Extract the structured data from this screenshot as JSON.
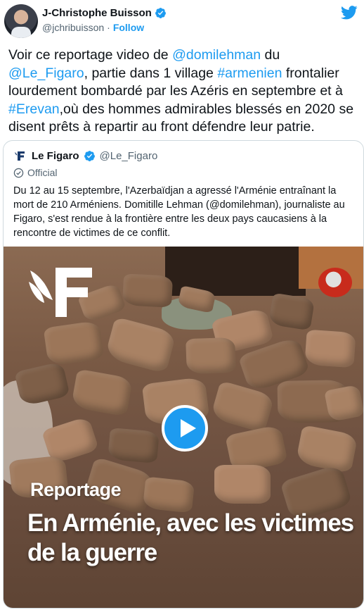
{
  "author": {
    "name": "J-Christophe Buisson",
    "handle": "@jchribuisson",
    "separator": "·",
    "follow_label": "Follow"
  },
  "tweet": {
    "segments": [
      {
        "text": "Voir ce reportage video de ",
        "link": false
      },
      {
        "text": "@domilehman",
        "link": true
      },
      {
        "text": " du ",
        "link": false
      },
      {
        "text": "@Le_Figaro",
        "link": true
      },
      {
        "text": ", partie dans 1 village ",
        "link": false
      },
      {
        "text": "#armenien",
        "link": true
      },
      {
        "text": " frontalier lourdement bombardé par les Azéris en septembre et à ",
        "link": false
      },
      {
        "text": "#Erevan",
        "link": true
      },
      {
        "text": ",où des hommes admirables blessés en 2020 se disent prêts à repartir au front défendre leur patrie.",
        "link": false
      }
    ]
  },
  "quoted": {
    "name": "Le Figaro",
    "handle": "@Le_Figaro",
    "official_label": "Official",
    "body": "Du 12 au 15 septembre, l'Azerbaïdjan a agressé l'Arménie entraînant la mort de 210 Arméniens. Domitille Lehman (@domilehman), journaliste au Figaro, s'est rendue à la frontière entre les deux pays caucasiens à la rencontre de victimes de ce conflit.",
    "video": {
      "caption_small": "Reportage",
      "caption_big": "En Arménie, avec les victimes de la guerre"
    }
  },
  "colors": {
    "link": "#1d9bf0",
    "verified": "#1d9bf0",
    "secondary_text": "#536471",
    "border": "#cfd9de"
  },
  "icons": [
    "verified-badge-icon",
    "twitter-bird-icon",
    "figaro-logo-icon",
    "official-check-icon",
    "play-icon"
  ]
}
